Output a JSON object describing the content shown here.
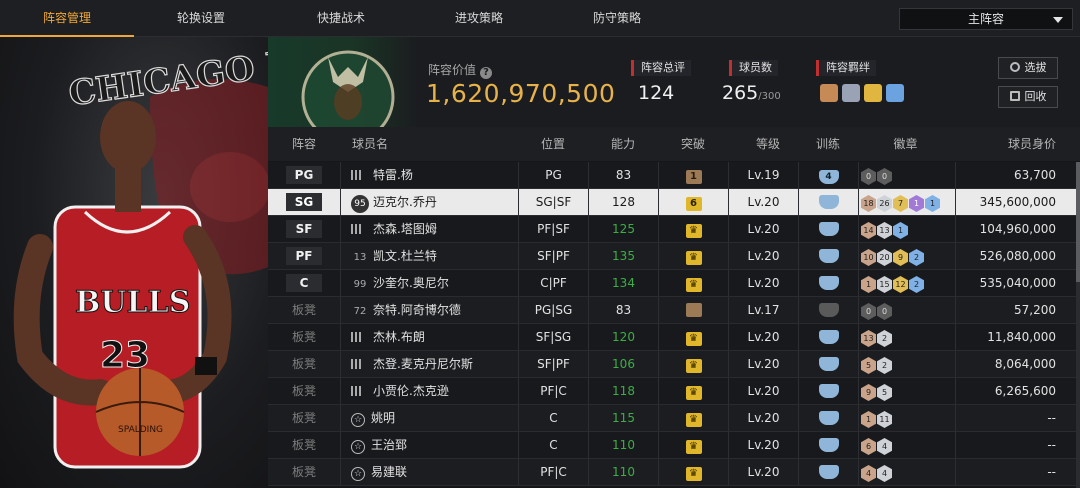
{
  "nav": {
    "tabs": [
      "阵容管理",
      "轮换设置",
      "快捷战术",
      "进攻策略",
      "防守策略"
    ],
    "active_tab": "阵容管理",
    "lineup_select": "主阵容"
  },
  "art": {
    "team_text": "CHICAGO BULLS",
    "jersey_text": "BULLS",
    "jersey_number": "23",
    "ball_text": "SPALDING"
  },
  "header": {
    "value_label": "阵容价值",
    "value": "1,620,970,500",
    "rating_label": "阵容总评",
    "rating": "124",
    "players_label": "球员数",
    "players": "265",
    "players_max": "/300",
    "bond_label": "阵容羁绊",
    "btn_select": "选拔",
    "btn_recycle": "回收"
  },
  "columns": [
    "阵容",
    "球员名",
    "位置",
    "能力",
    "突破",
    "等级",
    "训练",
    "徽章",
    "球员身价"
  ],
  "rows": [
    {
      "slot": "PG",
      "icon": "bars",
      "num": "",
      "name": "特雷.杨",
      "pos": "PG",
      "ability": "83",
      "green": false,
      "brk": "1",
      "brk_type": "brown",
      "level": "Lv.19",
      "train": "4",
      "badges": [
        [
          "gr",
          "0"
        ],
        [
          "gr",
          "0"
        ]
      ],
      "price": "63,700"
    },
    {
      "slot": "SG",
      "icon": "dark",
      "num": "95",
      "name": "迈克尔.乔丹",
      "pos": "SG|SF",
      "ability": "128",
      "green": false,
      "brk": "6",
      "brk_type": "gold",
      "level": "Lv.20",
      "train": "",
      "badges": [
        [
          "br",
          "18"
        ],
        [
          "si",
          "26"
        ],
        [
          "go",
          "7"
        ],
        [
          "pu",
          "1"
        ],
        [
          "bl",
          "1"
        ]
      ],
      "price": "345,600,000"
    },
    {
      "slot": "SF",
      "icon": "bars",
      "num": "",
      "name": "杰森.塔图姆",
      "pos": "PF|SF",
      "ability": "125",
      "green": true,
      "brk": "",
      "brk_type": "crown",
      "level": "Lv.20",
      "train": "",
      "badges": [
        [
          "br",
          "14"
        ],
        [
          "si",
          "13"
        ],
        [
          "bl",
          "1"
        ]
      ],
      "price": "104,960,000"
    },
    {
      "slot": "PF",
      "icon": "num",
      "num": "13",
      "name": "凯文.杜兰特",
      "pos": "SF|PF",
      "ability": "135",
      "green": true,
      "brk": "",
      "brk_type": "crown",
      "level": "Lv.20",
      "train": "",
      "badges": [
        [
          "br",
          "10"
        ],
        [
          "si",
          "20"
        ],
        [
          "go",
          "9"
        ],
        [
          "bl",
          "2"
        ]
      ],
      "price": "526,080,000"
    },
    {
      "slot": "C",
      "icon": "num",
      "num": "99",
      "name": "沙奎尔.奥尼尔",
      "pos": "C|PF",
      "ability": "134",
      "green": true,
      "brk": "",
      "brk_type": "crown",
      "level": "Lv.20",
      "train": "",
      "badges": [
        [
          "br",
          "1"
        ],
        [
          "si",
          "15"
        ],
        [
          "go",
          "12"
        ],
        [
          "bl",
          "2"
        ]
      ],
      "price": "535,040,000"
    },
    {
      "slot": "板凳",
      "icon": "num",
      "num": "72",
      "name": "奈特.阿奇博尔德",
      "pos": "PG|SG",
      "ability": "83",
      "green": false,
      "brk": "",
      "brk_type": "brown",
      "level": "Lv.17",
      "train": "",
      "grey_train": true,
      "badges": [
        [
          "gr",
          "0"
        ],
        [
          "gr",
          "0"
        ]
      ],
      "price": "57,200"
    },
    {
      "slot": "板凳",
      "icon": "bars",
      "num": "",
      "name": "杰林.布朗",
      "pos": "SF|SG",
      "ability": "120",
      "green": true,
      "brk": "",
      "brk_type": "crown",
      "level": "Lv.20",
      "train": "",
      "badges": [
        [
          "br",
          "13"
        ],
        [
          "si",
          "2"
        ]
      ],
      "price": "11,840,000"
    },
    {
      "slot": "板凳",
      "icon": "bars",
      "num": "",
      "name": "杰登.麦克丹尼尔斯",
      "pos": "SF|PF",
      "ability": "106",
      "green": true,
      "brk": "",
      "brk_type": "crown",
      "level": "Lv.20",
      "train": "",
      "badges": [
        [
          "br",
          "5"
        ],
        [
          "si",
          "2"
        ]
      ],
      "price": "8,064,000"
    },
    {
      "slot": "板凳",
      "icon": "bars",
      "num": "",
      "name": "小贾伦.杰克逊",
      "pos": "PF|C",
      "ability": "118",
      "green": true,
      "brk": "",
      "brk_type": "crown",
      "level": "Lv.20",
      "train": "",
      "badges": [
        [
          "br",
          "9"
        ],
        [
          "si",
          "5"
        ]
      ],
      "price": "6,265,600"
    },
    {
      "slot": "板凳",
      "icon": "star",
      "num": "",
      "name": "姚明",
      "pos": "C",
      "ability": "115",
      "green": true,
      "brk": "",
      "brk_type": "crown",
      "level": "Lv.20",
      "train": "",
      "badges": [
        [
          "br",
          "1"
        ],
        [
          "si",
          "11"
        ]
      ],
      "price": "--"
    },
    {
      "slot": "板凳",
      "icon": "star",
      "num": "",
      "name": "王治郅",
      "pos": "C",
      "ability": "110",
      "green": true,
      "brk": "",
      "brk_type": "crown",
      "level": "Lv.20",
      "train": "",
      "badges": [
        [
          "br",
          "6"
        ],
        [
          "si",
          "4"
        ]
      ],
      "price": "--"
    },
    {
      "slot": "板凳",
      "icon": "star",
      "num": "",
      "name": "易建联",
      "pos": "PF|C",
      "ability": "110",
      "green": true,
      "brk": "",
      "brk_type": "crown",
      "level": "Lv.20",
      "train": "",
      "badges": [
        [
          "br",
          "4"
        ],
        [
          "si",
          "4"
        ]
      ],
      "price": "--"
    }
  ],
  "colors": {
    "accent": "#f0a73a",
    "value_gold": "#e8b24a",
    "green": "#3cae45",
    "tag_red": "#c0302f",
    "bucks_green": "#1f4a33"
  }
}
